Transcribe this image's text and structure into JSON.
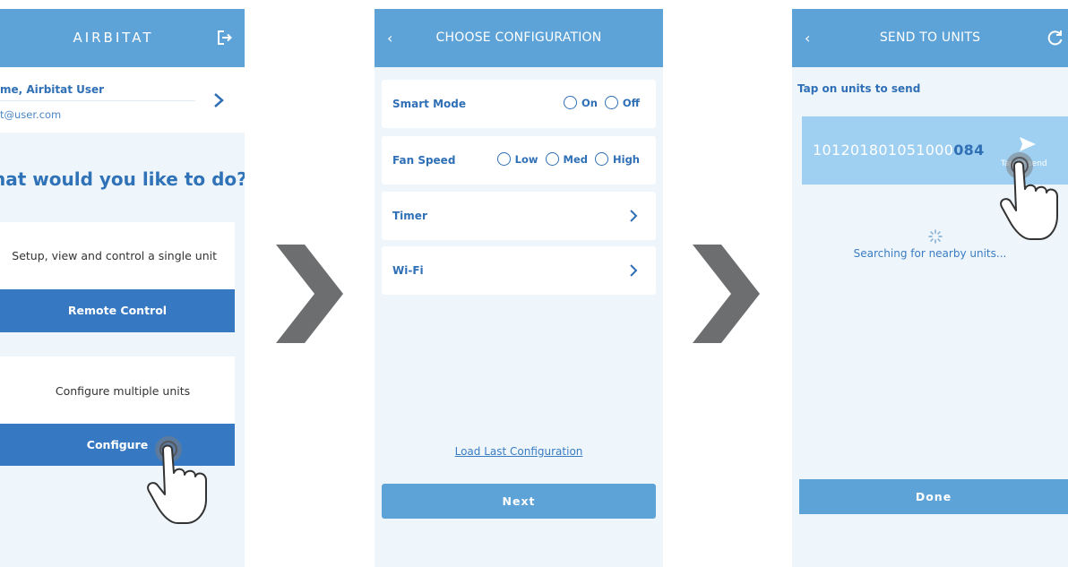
{
  "screen1": {
    "app_title": "AIRBITAT",
    "logout_icon": "logout-icon",
    "user_name": "me, Airbitat User",
    "user_email": "t@user.com",
    "question": "hat would you like to do?",
    "card1_text": "Setup, view and control a single unit",
    "remote_button": "Remote Control",
    "card2_text": "Configure multiple units",
    "configure_button": "Configure"
  },
  "screen2": {
    "back": "‹",
    "title": "CHOOSE CONFIGURATION",
    "smart_mode": {
      "label": "Smart Mode",
      "options": [
        "On",
        "Off"
      ]
    },
    "fan_speed": {
      "label": "Fan Speed",
      "options": [
        "Low",
        "Med",
        "High"
      ]
    },
    "timer_label": "Timer",
    "wifi_label": "Wi-Fi",
    "load_link": "Load Last Configuration",
    "next_button": "Next"
  },
  "screen3": {
    "back": "‹",
    "title": "SEND TO UNITS",
    "refresh_icon": "refresh-icon",
    "prompt": "Tap on units to send",
    "unit_id_prefix": "101201801051000",
    "unit_id_suffix": "084",
    "send_label": "Tap to send",
    "searching": "Searching for nearby units...",
    "done_button": "Done"
  },
  "colors": {
    "header": "#5ea3d8",
    "primary": "#3678c1",
    "text_blue": "#2f6fb5",
    "background": "#eef6fb",
    "unit_card": "#9fd0f1",
    "arrow": "#6d6e70"
  }
}
